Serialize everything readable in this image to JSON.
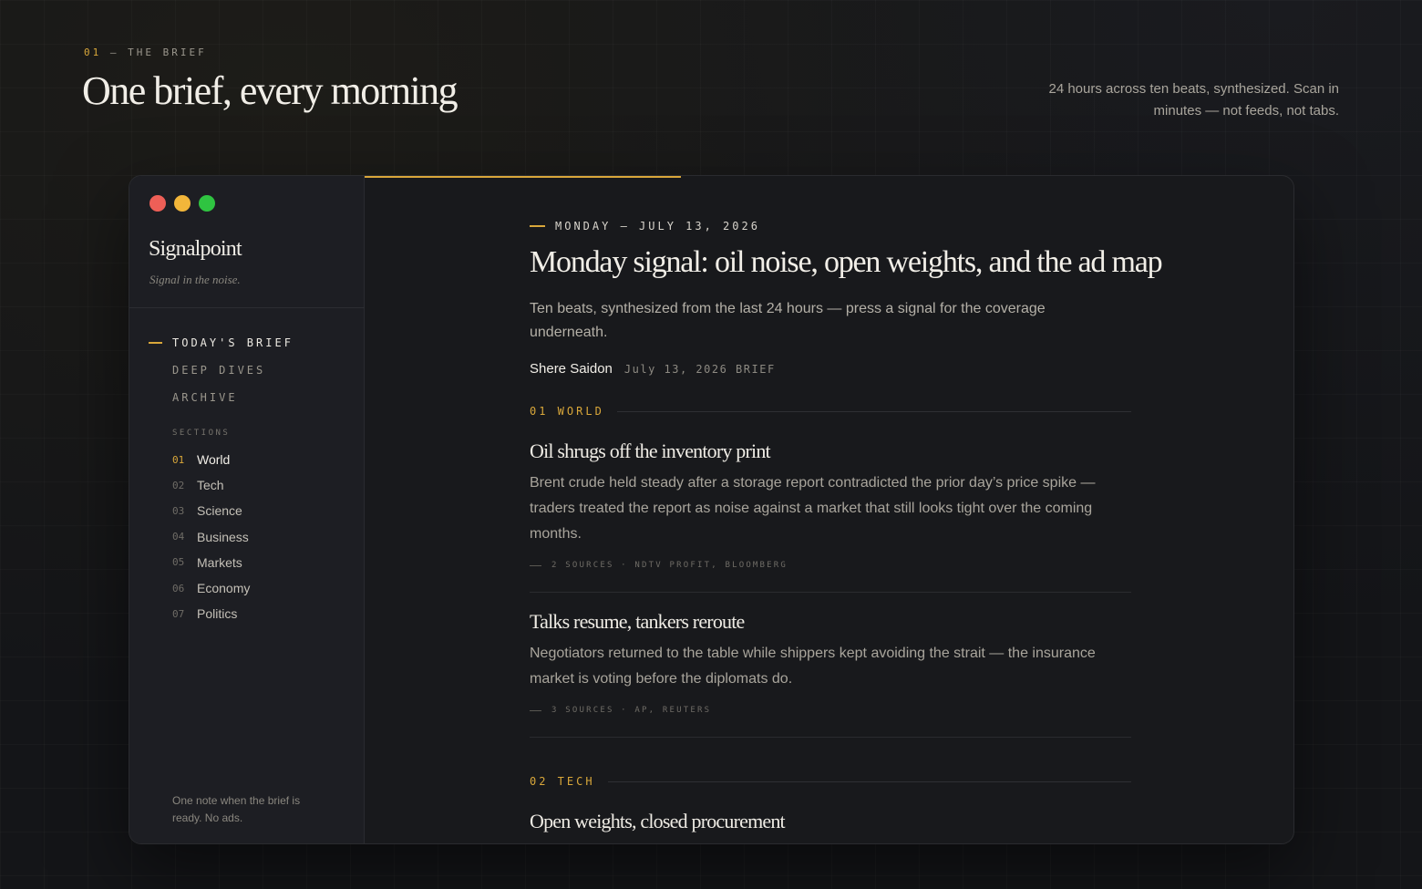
{
  "page": {
    "kicker_num": "01",
    "kicker_text": " — THE BRIEF",
    "title": "One brief, every morning",
    "subtitle": "24 hours across ten beats, synthesized. Scan in minutes — not feeds, not tabs."
  },
  "sidebar": {
    "brand": "Signalpoint",
    "tagline": "Signal in the noise.",
    "nav": [
      {
        "label": "TODAY'S BRIEF",
        "active": true
      },
      {
        "label": "DEEP DIVES",
        "active": false
      },
      {
        "label": "ARCHIVE",
        "active": false
      }
    ],
    "sections_label": "SECTIONS",
    "sections": [
      {
        "num": "01",
        "label": "World",
        "active": true
      },
      {
        "num": "02",
        "label": "Tech"
      },
      {
        "num": "03",
        "label": "Science"
      },
      {
        "num": "04",
        "label": "Business"
      },
      {
        "num": "05",
        "label": "Markets"
      },
      {
        "num": "06",
        "label": "Economy"
      },
      {
        "num": "07",
        "label": "Politics"
      }
    ],
    "footer": "One note when the brief is ready. No ads."
  },
  "main": {
    "progress_fraction": 0.34,
    "dateline": "MONDAY — JULY 13, 2026",
    "headline": "Monday signal: oil noise, open weights, and the ad map",
    "dek": "Ten beats, synthesized from the last 24 hours — press a signal for the coverage underneath.",
    "author": "Shere Saidon",
    "byline_meta": "July 13, 2026  BRIEF",
    "world_section": "01  WORLD",
    "stories": [
      {
        "title": "Oil shrugs off the inventory print",
        "body": "Brent crude held steady after a storage report contradicted the prior day’s price spike — traders treated the report as noise against a market that still looks tight over the coming months.",
        "sources": "2 SOURCES · NDTV PROFIT, BLOOMBERG"
      },
      {
        "title": "Talks resume, tankers reroute",
        "body": "Negotiators returned to the table while shippers kept avoiding the strait — the insurance market is voting before the diplomats do.",
        "sources": "3 SOURCES · AP, REUTERS"
      }
    ],
    "tech_section": "02  TECH",
    "tech_story_title": "Open weights, closed procurement"
  },
  "colors": {
    "accent": "#d9a73a",
    "background": "#141518",
    "sidebar": "#1d1e23",
    "window": "#18191c"
  }
}
